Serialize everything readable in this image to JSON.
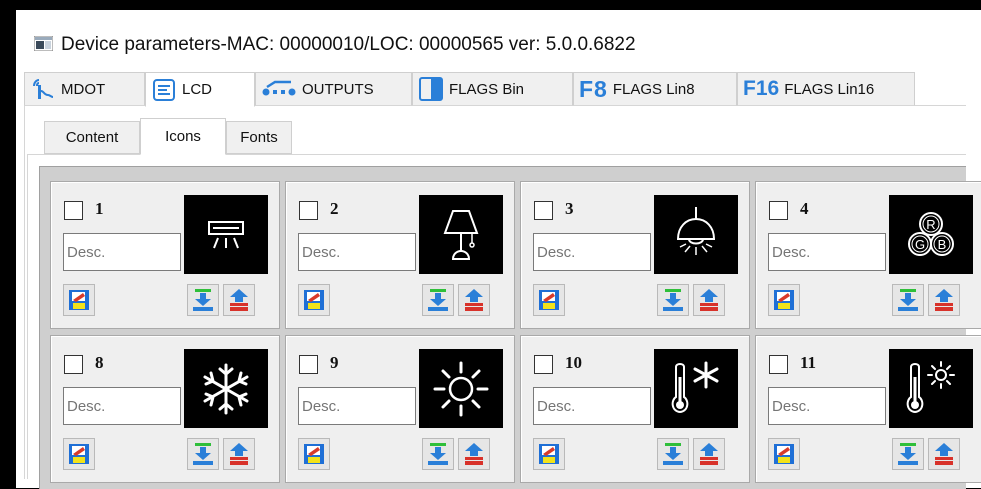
{
  "window": {
    "title": "Device parameters-MAC: 00000010/LOC: 00000565 ver: 5.0.0.6822"
  },
  "main_tabs": [
    {
      "label": "MDOT",
      "icon": "antenna-icon",
      "active": false
    },
    {
      "label": "LCD",
      "icon": "lcd-list-icon",
      "active": true
    },
    {
      "label": "OUTPUTS",
      "icon": "outputs-icon",
      "active": false
    },
    {
      "label": "FLAGS Bin",
      "icon": "flags-bin-icon",
      "active": false
    },
    {
      "label": "FLAGS Lin8",
      "icon": "f8-icon",
      "icon_text": "F8",
      "active": false
    },
    {
      "label": "FLAGS Lin16",
      "icon": "f16-icon",
      "icon_text": "F16",
      "active": false
    }
  ],
  "sub_tabs": [
    {
      "label": "Content",
      "active": false
    },
    {
      "label": "Icons",
      "active": true
    },
    {
      "label": "Fonts",
      "active": false
    }
  ],
  "icon_cells": [
    {
      "number": "1",
      "placeholder": "Desc.",
      "icon": "air-conditioner-icon"
    },
    {
      "number": "2",
      "placeholder": "Desc.",
      "icon": "table-lamp-icon"
    },
    {
      "number": "3",
      "placeholder": "Desc.",
      "icon": "ceiling-lamp-icon"
    },
    {
      "number": "4",
      "placeholder": "Desc.",
      "icon": "rgb-icon",
      "icon_letters": [
        "R",
        "G",
        "B"
      ]
    },
    {
      "number": "8",
      "placeholder": "Desc.",
      "icon": "snowflake-icon"
    },
    {
      "number": "9",
      "placeholder": "Desc.",
      "icon": "sun-icon"
    },
    {
      "number": "10",
      "placeholder": "Desc.",
      "icon": "thermometer-snow-icon"
    },
    {
      "number": "11",
      "placeholder": "Desc.",
      "icon": "thermometer-sun-icon"
    }
  ],
  "colors": {
    "save_blue": "#1e6fd6",
    "save_red": "#d83a2a",
    "save_yellow": "#f2e21a",
    "download_green": "#2fbf3a",
    "upload_red": "#d8322a",
    "arrow_blue": "#2a7fd8"
  }
}
